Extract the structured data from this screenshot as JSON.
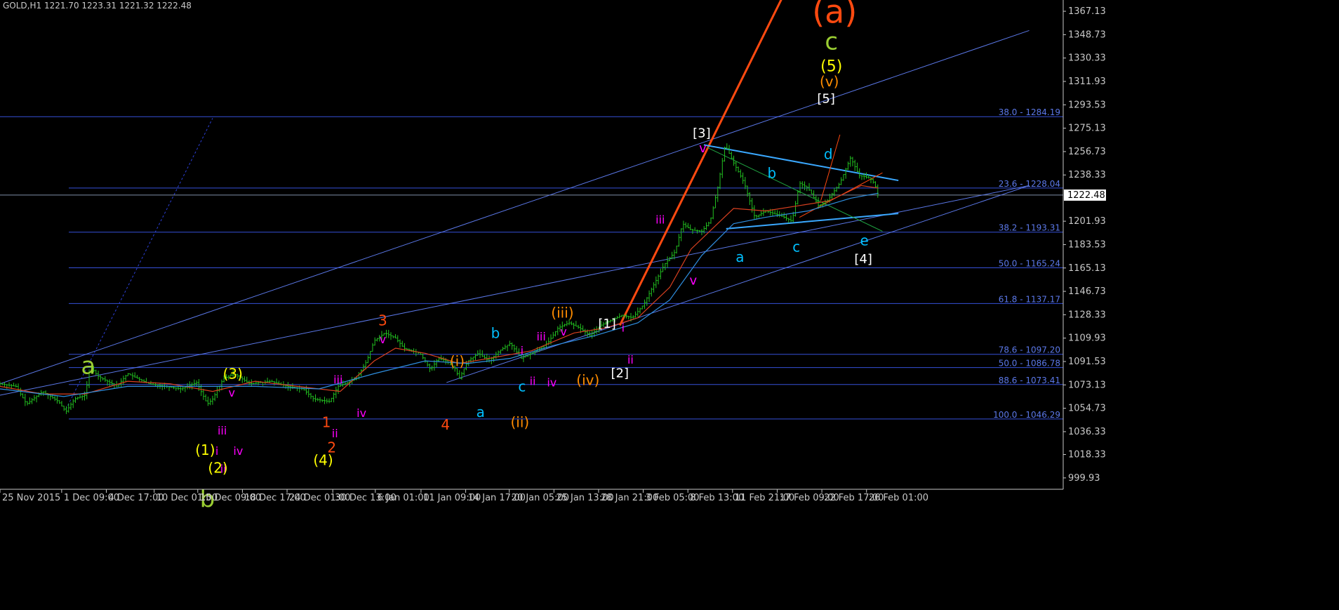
{
  "header": {
    "text": "GOLD,H1  1221.70 1223.31 1221.32 1222.48"
  },
  "chart_data": {
    "type": "candlestick",
    "symbol": "GOLD",
    "timeframe": "H1",
    "ohlc_header": {
      "open": 1221.7,
      "high": 1223.31,
      "low": 1221.32,
      "close": 1222.48
    },
    "current_price": 1222.48,
    "current_price_label": "1222.48",
    "ylim": [
      991.0,
      1376.0
    ],
    "xlim": [
      0,
      1000
    ],
    "y_ticks": [
      {
        "v": 1367.13,
        "label": "1367.13"
      },
      {
        "v": 1348.73,
        "label": "1348.73"
      },
      {
        "v": 1330.33,
        "label": "1330.33"
      },
      {
        "v": 1311.93,
        "label": "1311.93"
      },
      {
        "v": 1293.53,
        "label": "1293.53"
      },
      {
        "v": 1275.13,
        "label": "1275.13"
      },
      {
        "v": 1256.73,
        "label": "1256.73"
      },
      {
        "v": 1238.33,
        "label": "1238.33"
      },
      {
        "v": 1201.93,
        "label": "1201.93"
      },
      {
        "v": 1183.53,
        "label": "1183.53"
      },
      {
        "v": 1165.13,
        "label": "1165.13"
      },
      {
        "v": 1146.73,
        "label": "1146.73"
      },
      {
        "v": 1128.33,
        "label": "1128.33"
      },
      {
        "v": 1109.93,
        "label": "1109.93"
      },
      {
        "v": 1091.53,
        "label": "1091.53"
      },
      {
        "v": 1073.13,
        "label": "1073.13"
      },
      {
        "v": 1054.73,
        "label": "1054.73"
      },
      {
        "v": 1036.33,
        "label": "1036.33"
      },
      {
        "v": 1018.33,
        "label": "1018.33"
      },
      {
        "v": 999.93,
        "label": "999.93"
      }
    ],
    "x_ticks": [
      {
        "x": 0,
        "label": "25 Nov 2015"
      },
      {
        "x": 58,
        "label": "1 Dec 09:00"
      },
      {
        "x": 100,
        "label": "4 Dec 17:00"
      },
      {
        "x": 145,
        "label": "10 Dec 01:00"
      },
      {
        "x": 186,
        "label": "15 Dec 09:00"
      },
      {
        "x": 228,
        "label": "18 Dec 17:00"
      },
      {
        "x": 270,
        "label": "24 Dec 01:00"
      },
      {
        "x": 313,
        "label": "30 Dec 13:00"
      },
      {
        "x": 353,
        "label": "6 Jan 01:00"
      },
      {
        "x": 396,
        "label": "11 Jan 09:00"
      },
      {
        "x": 438,
        "label": "14 Jan 17:00"
      },
      {
        "x": 479,
        "label": "20 Jan 05:00"
      },
      {
        "x": 521,
        "label": "25 Jan 13:00"
      },
      {
        "x": 563,
        "label": "28 Jan 21:00"
      },
      {
        "x": 605,
        "label": "3 Feb 05:00"
      },
      {
        "x": 647,
        "label": "8 Feb 13:00"
      },
      {
        "x": 689,
        "label": "11 Feb 21:00"
      },
      {
        "x": 731,
        "label": "17 Feb 09:00"
      },
      {
        "x": 773,
        "label": "22 Feb 17:00"
      },
      {
        "x": 815,
        "label": "26 Feb 01:00"
      }
    ],
    "price_path": [
      [
        0,
        1074
      ],
      [
        15,
        1072
      ],
      [
        25,
        1058
      ],
      [
        40,
        1068
      ],
      [
        55,
        1060
      ],
      [
        62,
        1052
      ],
      [
        70,
        1062
      ],
      [
        80,
        1065
      ],
      [
        85,
        1088
      ],
      [
        92,
        1080
      ],
      [
        110,
        1072
      ],
      [
        120,
        1082
      ],
      [
        140,
        1074
      ],
      [
        170,
        1070
      ],
      [
        185,
        1075
      ],
      [
        195,
        1058
      ],
      [
        200,
        1062
      ],
      [
        210,
        1078
      ],
      [
        220,
        1082
      ],
      [
        235,
        1074
      ],
      [
        255,
        1076
      ],
      [
        270,
        1072
      ],
      [
        285,
        1070
      ],
      [
        295,
        1062
      ],
      [
        310,
        1060
      ],
      [
        318,
        1072
      ],
      [
        335,
        1078
      ],
      [
        345,
        1092
      ],
      [
        352,
        1108
      ],
      [
        362,
        1114
      ],
      [
        372,
        1110
      ],
      [
        380,
        1102
      ],
      [
        395,
        1098
      ],
      [
        405,
        1085
      ],
      [
        412,
        1094
      ],
      [
        420,
        1092
      ],
      [
        428,
        1086
      ],
      [
        432,
        1078
      ],
      [
        440,
        1092
      ],
      [
        450,
        1098
      ],
      [
        460,
        1092
      ],
      [
        470,
        1100
      ],
      [
        480,
        1106
      ],
      [
        490,
        1094
      ],
      [
        500,
        1098
      ],
      [
        515,
        1106
      ],
      [
        525,
        1118
      ],
      [
        535,
        1122
      ],
      [
        545,
        1118
      ],
      [
        555,
        1112
      ],
      [
        565,
        1120
      ],
      [
        575,
        1124
      ],
      [
        585,
        1128
      ],
      [
        595,
        1126
      ],
      [
        605,
        1136
      ],
      [
        615,
        1152
      ],
      [
        625,
        1168
      ],
      [
        635,
        1178
      ],
      [
        642,
        1200
      ],
      [
        650,
        1195
      ],
      [
        660,
        1194
      ],
      [
        668,
        1202
      ],
      [
        675,
        1228
      ],
      [
        682,
        1262
      ],
      [
        690,
        1248
      ],
      [
        700,
        1232
      ],
      [
        710,
        1205
      ],
      [
        720,
        1210
      ],
      [
        735,
        1206
      ],
      [
        745,
        1202
      ],
      [
        752,
        1232
      ],
      [
        760,
        1228
      ],
      [
        770,
        1214
      ],
      [
        778,
        1218
      ],
      [
        790,
        1232
      ],
      [
        800,
        1252
      ],
      [
        808,
        1238
      ],
      [
        818,
        1236
      ],
      [
        822,
        1232
      ],
      [
        825,
        1226
      ],
      [
        826,
        1222
      ]
    ],
    "ma_fast": [
      [
        0,
        1072
      ],
      [
        40,
        1066
      ],
      [
        80,
        1066
      ],
      [
        120,
        1076
      ],
      [
        160,
        1074
      ],
      [
        200,
        1068
      ],
      [
        240,
        1076
      ],
      [
        280,
        1072
      ],
      [
        320,
        1068
      ],
      [
        352,
        1092
      ],
      [
        372,
        1102
      ],
      [
        400,
        1098
      ],
      [
        432,
        1090
      ],
      [
        460,
        1094
      ],
      [
        500,
        1100
      ],
      [
        540,
        1114
      ],
      [
        570,
        1118
      ],
      [
        600,
        1126
      ],
      [
        630,
        1150
      ],
      [
        650,
        1180
      ],
      [
        670,
        1196
      ],
      [
        690,
        1212
      ],
      [
        720,
        1210
      ],
      [
        750,
        1214
      ],
      [
        780,
        1218
      ],
      [
        810,
        1230
      ],
      [
        826,
        1228
      ]
    ],
    "ma_slow": [
      [
        0,
        1070
      ],
      [
        60,
        1064
      ],
      [
        120,
        1072
      ],
      [
        180,
        1072
      ],
      [
        240,
        1072
      ],
      [
        300,
        1070
      ],
      [
        352,
        1082
      ],
      [
        400,
        1092
      ],
      [
        440,
        1090
      ],
      [
        480,
        1094
      ],
      [
        520,
        1104
      ],
      [
        560,
        1112
      ],
      [
        600,
        1122
      ],
      [
        630,
        1140
      ],
      [
        660,
        1175
      ],
      [
        690,
        1200
      ],
      [
        720,
        1205
      ],
      [
        760,
        1210
      ],
      [
        800,
        1220
      ],
      [
        826,
        1224
      ]
    ],
    "fib_levels": [
      {
        "v": 1284.19,
        "label": "38.0 - 1284.19"
      },
      {
        "v": 1228.04,
        "label": "23.6 - 1228.04"
      },
      {
        "v": 1193.31,
        "label": "38.2 - 1193.31"
      },
      {
        "v": 1165.24,
        "label": "50.0 - 1165.24"
      },
      {
        "v": 1137.17,
        "label": "61.8 - 1137.17"
      },
      {
        "v": 1097.2,
        "label": "78.6 - 1097.20"
      },
      {
        "v": 1086.78,
        "label": "50.0 - 1086.78"
      },
      {
        "v": 1073.41,
        "label": "88.6 - 1073.41"
      },
      {
        "v": 1046.29,
        "label": "100.0 - 1046.29"
      }
    ],
    "wave_labels": [
      {
        "text": "(a)",
        "x": 785,
        "y": 1358,
        "color": "#ff4a10",
        "size": 46
      },
      {
        "text": "c",
        "x": 782,
        "y": 1337,
        "color": "#9acd32",
        "size": 34
      },
      {
        "text": "(5)",
        "x": 782,
        "y": 1320,
        "color": "#ffff00",
        "size": 22
      },
      {
        "text": "(v)",
        "x": 780,
        "y": 1308,
        "color": "#ff8c00",
        "size": 20
      },
      {
        "text": "[5]",
        "x": 777,
        "y": 1295,
        "color": "#ffffff",
        "size": 18
      },
      {
        "text": "[3]",
        "x": 660,
        "y": 1268,
        "color": "#ffffff",
        "size": 18
      },
      {
        "text": "v",
        "x": 661,
        "y": 1256,
        "color": "#ff00ff",
        "size": 18
      },
      {
        "text": "iii",
        "x": 621,
        "y": 1200,
        "color": "#ff00ff",
        "size": 16
      },
      {
        "text": "v",
        "x": 652,
        "y": 1152,
        "color": "#ff00ff",
        "size": 18
      },
      {
        "text": "a",
        "x": 696,
        "y": 1170,
        "color": "#00bfff",
        "size": 20
      },
      {
        "text": "b",
        "x": 726,
        "y": 1236,
        "color": "#00bfff",
        "size": 20
      },
      {
        "text": "c",
        "x": 749,
        "y": 1178,
        "color": "#00bfff",
        "size": 20
      },
      {
        "text": "d",
        "x": 779,
        "y": 1251,
        "color": "#00bfff",
        "size": 20
      },
      {
        "text": "e",
        "x": 813,
        "y": 1183,
        "color": "#00bfff",
        "size": 20
      },
      {
        "text": "[4]",
        "x": 812,
        "y": 1169,
        "color": "#ffffff",
        "size": 18
      },
      {
        "text": "[1]",
        "x": 571,
        "y": 1118,
        "color": "#ffffff",
        "size": 18
      },
      {
        "text": "i",
        "x": 586,
        "y": 1115,
        "color": "#ff00ff",
        "size": 16
      },
      {
        "text": "ii",
        "x": 593,
        "y": 1090,
        "color": "#ff00ff",
        "size": 16
      },
      {
        "text": "[2]",
        "x": 583,
        "y": 1079,
        "color": "#ffffff",
        "size": 18
      },
      {
        "text": "(iii)",
        "x": 529,
        "y": 1126,
        "color": "#ff8c00",
        "size": 20
      },
      {
        "text": "v",
        "x": 530,
        "y": 1112,
        "color": "#ff00ff",
        "size": 16
      },
      {
        "text": "iii",
        "x": 509,
        "y": 1108,
        "color": "#ff00ff",
        "size": 16
      },
      {
        "text": "(iv)",
        "x": 553,
        "y": 1073,
        "color": "#ff8c00",
        "size": 20
      },
      {
        "text": "iv",
        "x": 519,
        "y": 1072,
        "color": "#ff00ff",
        "size": 16
      },
      {
        "text": "i",
        "x": 491,
        "y": 1097,
        "color": "#ff00ff",
        "size": 16
      },
      {
        "text": "ii",
        "x": 501,
        "y": 1073,
        "color": "#ff00ff",
        "size": 16
      },
      {
        "text": "b",
        "x": 466,
        "y": 1110,
        "color": "#00bfff",
        "size": 20
      },
      {
        "text": "c",
        "x": 491,
        "y": 1068,
        "color": "#00bfff",
        "size": 20
      },
      {
        "text": "a",
        "x": 452,
        "y": 1048,
        "color": "#00bfff",
        "size": 20
      },
      {
        "text": "(ii)",
        "x": 489,
        "y": 1040,
        "color": "#ff8c00",
        "size": 20
      },
      {
        "text": "(i)",
        "x": 430,
        "y": 1088,
        "color": "#ff8c00",
        "size": 20
      },
      {
        "text": "4",
        "x": 419,
        "y": 1038,
        "color": "#ff4a10",
        "size": 20
      },
      {
        "text": "3",
        "x": 360,
        "y": 1120,
        "color": "#ff4a10",
        "size": 20
      },
      {
        "text": "v",
        "x": 360,
        "y": 1106,
        "color": "#ff00ff",
        "size": 16
      },
      {
        "text": "iii",
        "x": 318,
        "y": 1074,
        "color": "#ff00ff",
        "size": 16
      },
      {
        "text": "iv",
        "x": 340,
        "y": 1048,
        "color": "#ff00ff",
        "size": 16
      },
      {
        "text": "1",
        "x": 307,
        "y": 1040,
        "color": "#ff4a10",
        "size": 20
      },
      {
        "text": "ii",
        "x": 315,
        "y": 1032,
        "color": "#ff00ff",
        "size": 16
      },
      {
        "text": "2",
        "x": 312,
        "y": 1020,
        "color": "#ff4a10",
        "size": 20
      },
      {
        "text": "(4)",
        "x": 304,
        "y": 1010,
        "color": "#ffff00",
        "size": 20
      },
      {
        "text": "(3)",
        "x": 219,
        "y": 1078,
        "color": "#ffff00",
        "size": 20
      },
      {
        "text": "v",
        "x": 218,
        "y": 1064,
        "color": "#ff00ff",
        "size": 16
      },
      {
        "text": "iii",
        "x": 209,
        "y": 1034,
        "color": "#ff00ff",
        "size": 16
      },
      {
        "text": "iv",
        "x": 224,
        "y": 1018,
        "color": "#ff00ff",
        "size": 16
      },
      {
        "text": "i",
        "x": 204,
        "y": 1018,
        "color": "#ff00ff",
        "size": 16
      },
      {
        "text": "ii",
        "x": 210,
        "y": 1004,
        "color": "#ff00ff",
        "size": 16
      },
      {
        "text": "(1)",
        "x": 193,
        "y": 1018,
        "color": "#ffff00",
        "size": 20
      },
      {
        "text": "(2)",
        "x": 205,
        "y": 1004,
        "color": "#ffff00",
        "size": 20
      },
      {
        "text": "b",
        "x": 195,
        "y": 977,
        "color": "#9acd32",
        "size": 34
      },
      {
        "text": "a",
        "x": 83,
        "y": 1082,
        "color": "#9acd32",
        "size": 34
      }
    ],
    "lines": [
      {
        "x1": 0,
        "y1": 1074,
        "x2": 968,
        "y2": 1352,
        "color": "#5b78e8",
        "width": 1
      },
      {
        "x1": 0,
        "y1": 1065,
        "x2": 968,
        "y2": 1230,
        "color": "#5b78e8",
        "width": 1
      },
      {
        "x1": 420,
        "y1": 1075,
        "x2": 968,
        "y2": 1230,
        "color": "#5b78e8",
        "width": 1
      },
      {
        "x1": 583,
        "y1": 1120,
        "x2": 737,
        "y2": 1380,
        "color": "#ff4a10",
        "width": 3
      },
      {
        "x1": 662,
        "y1": 1262,
        "x2": 845,
        "y2": 1234,
        "color": "#3aa8ff",
        "width": 2
      },
      {
        "x1": 683,
        "y1": 1196,
        "x2": 845,
        "y2": 1208,
        "color": "#3aa8ff",
        "width": 2
      },
      {
        "x1": 665,
        "y1": 1260,
        "x2": 830,
        "y2": 1194,
        "color": "#1fa040",
        "width": 1
      },
      {
        "x1": 752,
        "y1": 1205,
        "x2": 830,
        "y2": 1240,
        "color": "#ff4a10",
        "width": 1
      },
      {
        "x1": 772,
        "y1": 1218,
        "x2": 790,
        "y2": 1270,
        "color": "#ff4a10",
        "width": 1
      },
      {
        "x1": 62,
        "y1": 1054,
        "x2": 200,
        "y2": 1283,
        "color": "#2b3fd6",
        "width": 1,
        "dash": true
      }
    ]
  }
}
